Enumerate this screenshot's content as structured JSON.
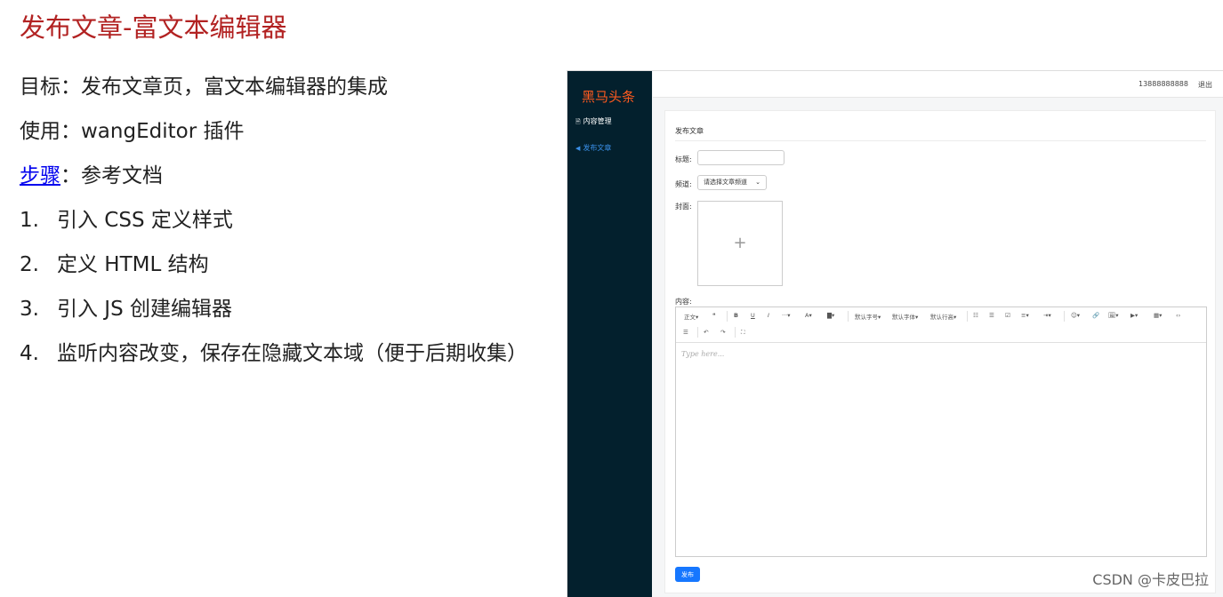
{
  "slide": {
    "title": "发布文章-富文本编辑器",
    "goal": "目标：发布文章页，富文本编辑器的集成",
    "usage": "使用：wangEditor 插件",
    "steps_link": "步骤",
    "steps_rest": "：参考文档",
    "steps": [
      {
        "num": "1.",
        "text": "引入 CSS 定义样式"
      },
      {
        "num": "2.",
        "text": "定义 HTML 结构"
      },
      {
        "num": "3.",
        "text": "引入 JS 创建编辑器"
      },
      {
        "num": "4.",
        "text": "监听内容改变，保存在隐藏文本域（便于后期收集）"
      }
    ]
  },
  "app": {
    "logo": "黑马头条",
    "nav": [
      {
        "icon": "document-icon",
        "glyph": "🗎",
        "label": "内容管理"
      },
      {
        "icon": "send-icon",
        "glyph": "◀",
        "label": "发布文章"
      }
    ],
    "header": {
      "phone": "13888888888",
      "logout": "退出"
    },
    "card_title": "发布文章",
    "form": {
      "title_label": "标题:",
      "title_value": "",
      "channel_label": "频道:",
      "channel_selected": "请选择文章频道",
      "cover_label": "封面:",
      "content_label": "内容:"
    },
    "editor": {
      "toolbar_row1": [
        "正文▾",
        "❝",
        "B",
        "U",
        "I",
        "···▾",
        "A▾",
        "▇▾",
        "默认字号▾",
        "默认字体▾",
        "默认行高▾",
        "☷",
        "☰",
        "☑",
        "≡▾",
        "⇥▾",
        "☺▾",
        "🔗",
        "🖼▾",
        "▶▾",
        "▦▾",
        "‹›"
      ],
      "toolbar_row2": [
        "☰",
        "↶",
        "↷",
        "⛶"
      ],
      "placeholder": "Type here..."
    },
    "publish_button": "发布"
  },
  "watermark": "CSDN @卡皮巴拉"
}
